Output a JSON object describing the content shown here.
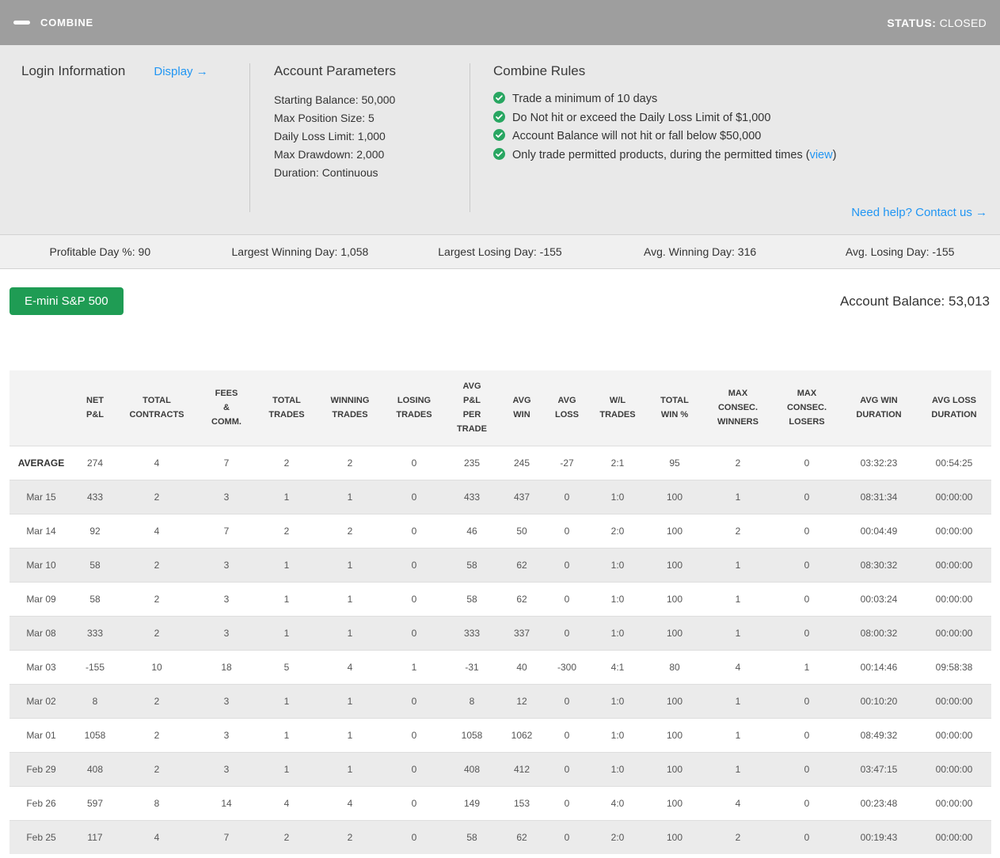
{
  "header": {
    "title": "COMBINE",
    "status_label": "STATUS:",
    "status_value": "CLOSED"
  },
  "login_info": {
    "title": "Login Information",
    "display_link": "Display →"
  },
  "account_parameters": {
    "title": "Account Parameters",
    "items": [
      "Starting Balance: 50,000",
      "Max Position Size: 5",
      "Daily Loss Limit: 1,000",
      "Max Drawdown: 2,000",
      "Duration: Continuous"
    ]
  },
  "combine_rules": {
    "title": "Combine Rules",
    "check_icon": "check-circle-icon",
    "rules": [
      {
        "text": "Trade a minimum of 10 days",
        "link": "",
        "suffix": ""
      },
      {
        "text": "Do Not hit or exceed the Daily Loss Limit of $1,000",
        "link": "",
        "suffix": ""
      },
      {
        "text": "Account Balance will not hit or fall below $50,000",
        "link": "",
        "suffix": ""
      },
      {
        "text": "Only trade permitted products, during the permitted times (",
        "link": "view",
        "suffix": ")"
      }
    ],
    "help_link": "Need help? Contact us →"
  },
  "stats_bar": {
    "items": [
      "Profitable Day %: 90",
      "Largest Winning Day: 1,058",
      "Largest Losing Day: -155",
      "Avg. Winning Day: 316",
      "Avg. Losing Day: -155"
    ]
  },
  "balance_row": {
    "product_button": "E-mini S&P 500",
    "account_balance": "Account Balance: 53,013"
  },
  "colors": {
    "topbar_gray": "#9e9e9e",
    "accent_blue": "#2196f3",
    "button_green": "#1f9c54",
    "check_green": "#28a661",
    "section_bg": "#e9e9e9",
    "stats_bg": "#f0f0f0",
    "row_stripe": "#ebebeb"
  },
  "table": {
    "columns": [
      "",
      "NET\nP&L",
      "TOTAL\nCONTRACTS",
      "FEES\n&\nCOMM.",
      "TOTAL\nTRADES",
      "WINNING\nTRADES",
      "LOSING\nTRADES",
      "AVG\nP&L\nPER\nTRADE",
      "AVG\nWIN",
      "AVG\nLOSS",
      "W/L\nTRADES",
      "TOTAL\nWIN %",
      "MAX\nCONSEC.\nWINNERS",
      "MAX\nCONSEC.\nLOSERS",
      "AVG WIN\nDURATION",
      "AVG LOSS\nDURATION"
    ],
    "rows": [
      {
        "label": "AVERAGE",
        "values": [
          "274",
          "4",
          "7",
          "2",
          "2",
          "0",
          "235",
          "245",
          "-27",
          "2:1",
          "95",
          "2",
          "0",
          "03:32:23",
          "00:54:25"
        ]
      },
      {
        "label": "Mar 15",
        "values": [
          "433",
          "2",
          "3",
          "1",
          "1",
          "0",
          "433",
          "437",
          "0",
          "1:0",
          "100",
          "1",
          "0",
          "08:31:34",
          "00:00:00"
        ]
      },
      {
        "label": "Mar 14",
        "values": [
          "92",
          "4",
          "7",
          "2",
          "2",
          "0",
          "46",
          "50",
          "0",
          "2:0",
          "100",
          "2",
          "0",
          "00:04:49",
          "00:00:00"
        ]
      },
      {
        "label": "Mar 10",
        "values": [
          "58",
          "2",
          "3",
          "1",
          "1",
          "0",
          "58",
          "62",
          "0",
          "1:0",
          "100",
          "1",
          "0",
          "08:30:32",
          "00:00:00"
        ]
      },
      {
        "label": "Mar 09",
        "values": [
          "58",
          "2",
          "3",
          "1",
          "1",
          "0",
          "58",
          "62",
          "0",
          "1:0",
          "100",
          "1",
          "0",
          "00:03:24",
          "00:00:00"
        ]
      },
      {
        "label": "Mar 08",
        "values": [
          "333",
          "2",
          "3",
          "1",
          "1",
          "0",
          "333",
          "337",
          "0",
          "1:0",
          "100",
          "1",
          "0",
          "08:00:32",
          "00:00:00"
        ]
      },
      {
        "label": "Mar 03",
        "values": [
          "-155",
          "10",
          "18",
          "5",
          "4",
          "1",
          "-31",
          "40",
          "-300",
          "4:1",
          "80",
          "4",
          "1",
          "00:14:46",
          "09:58:38"
        ]
      },
      {
        "label": "Mar 02",
        "values": [
          "8",
          "2",
          "3",
          "1",
          "1",
          "0",
          "8",
          "12",
          "0",
          "1:0",
          "100",
          "1",
          "0",
          "00:10:20",
          "00:00:00"
        ]
      },
      {
        "label": "Mar 01",
        "values": [
          "1058",
          "2",
          "3",
          "1",
          "1",
          "0",
          "1058",
          "1062",
          "0",
          "1:0",
          "100",
          "1",
          "0",
          "08:49:32",
          "00:00:00"
        ]
      },
      {
        "label": "Feb 29",
        "values": [
          "408",
          "2",
          "3",
          "1",
          "1",
          "0",
          "408",
          "412",
          "0",
          "1:0",
          "100",
          "1",
          "0",
          "03:47:15",
          "00:00:00"
        ]
      },
      {
        "label": "Feb 26",
        "values": [
          "597",
          "8",
          "14",
          "4",
          "4",
          "0",
          "149",
          "153",
          "0",
          "4:0",
          "100",
          "4",
          "0",
          "00:23:48",
          "00:00:00"
        ]
      },
      {
        "label": "Feb 25",
        "values": [
          "117",
          "4",
          "7",
          "2",
          "2",
          "0",
          "58",
          "62",
          "0",
          "2:0",
          "100",
          "2",
          "0",
          "00:19:43",
          "00:00:00"
        ]
      }
    ]
  }
}
